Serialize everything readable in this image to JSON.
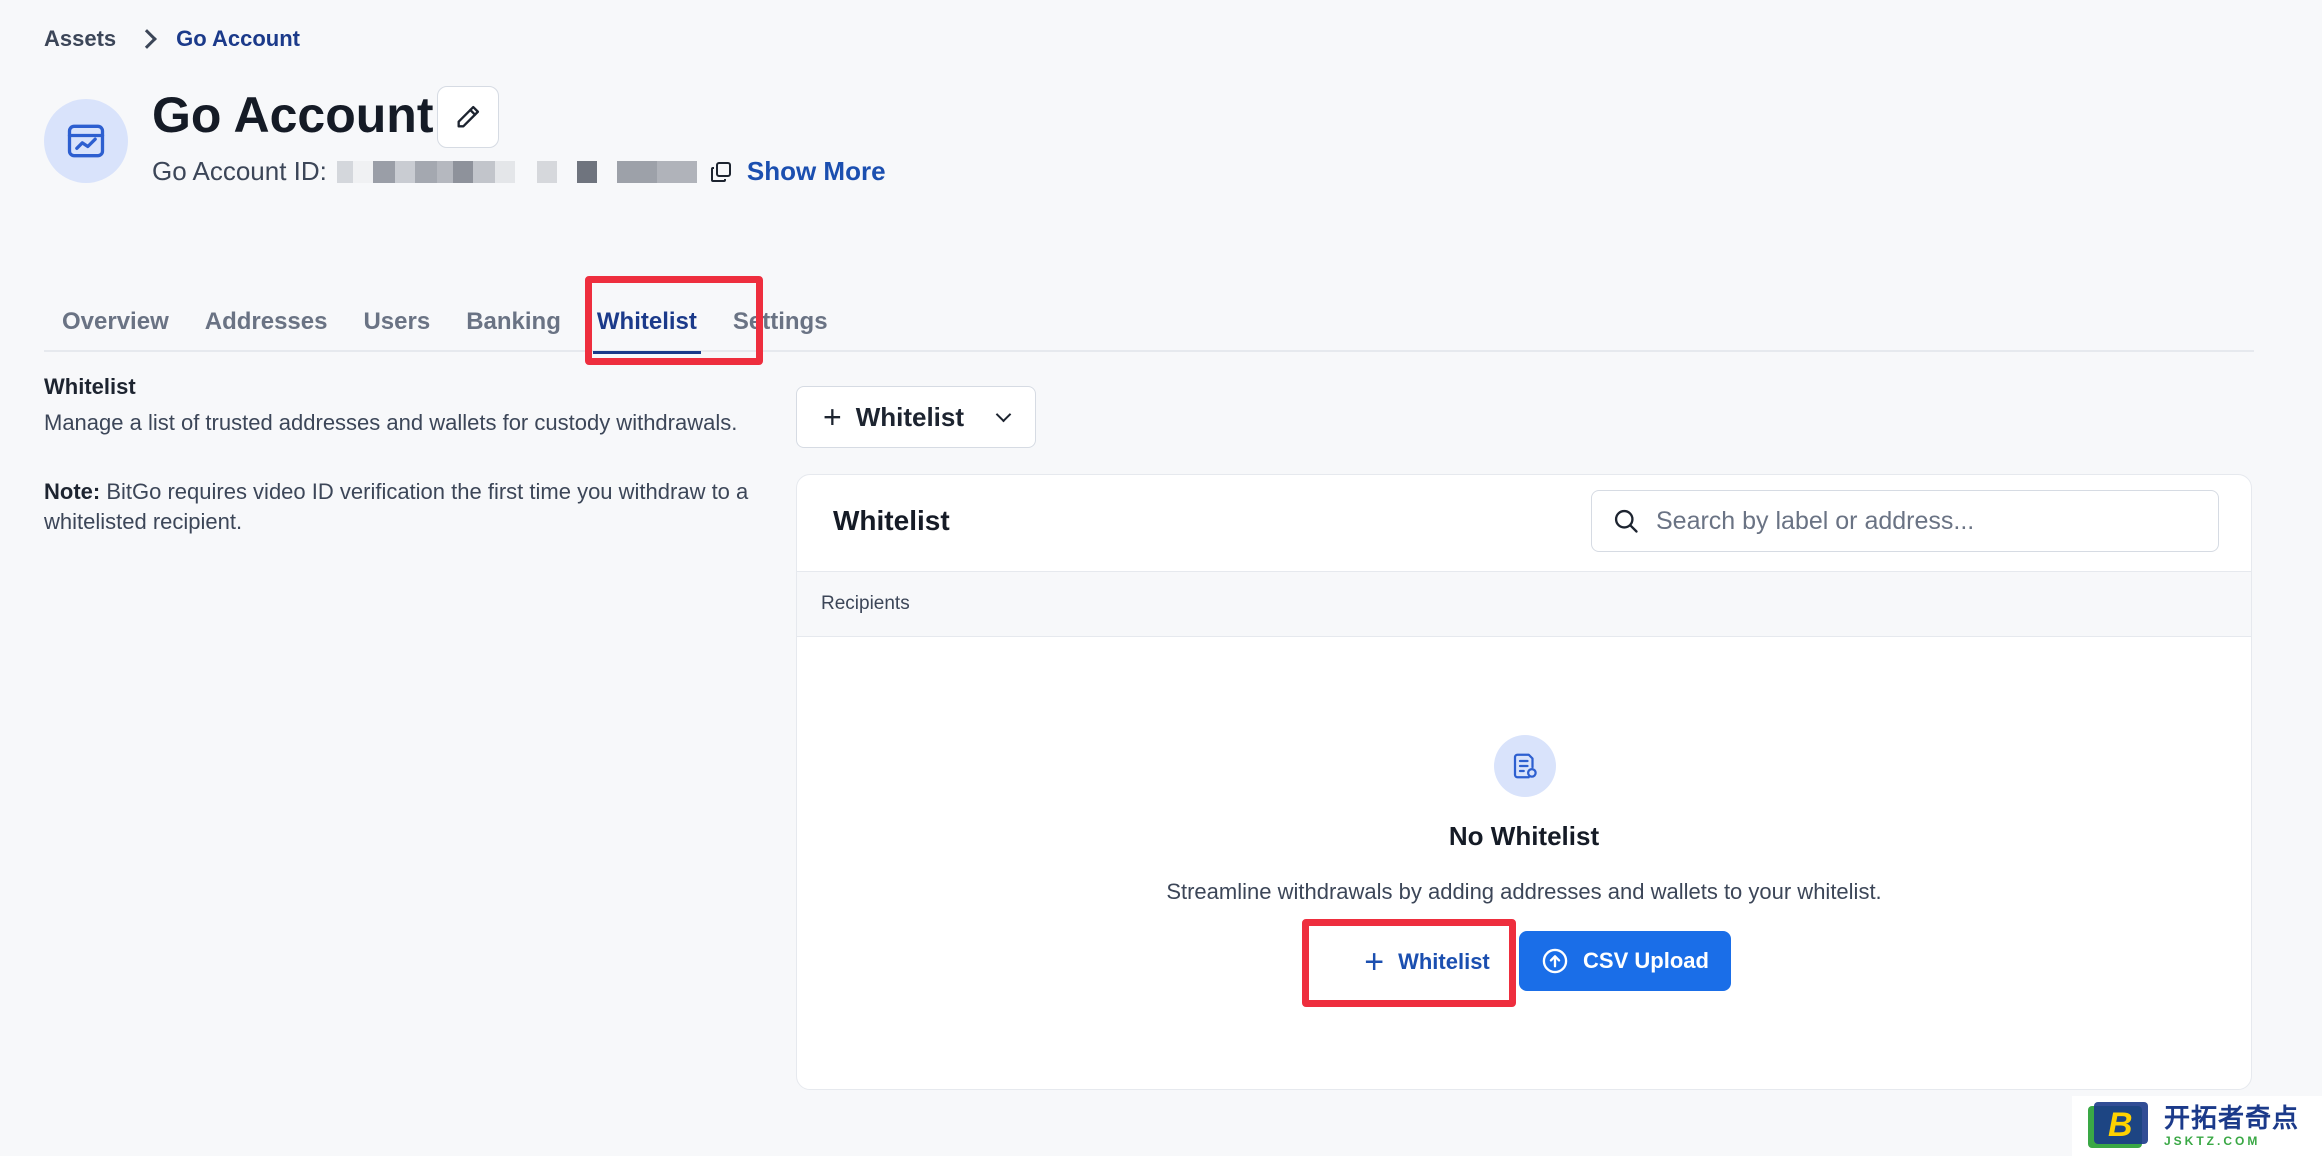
{
  "breadcrumb": {
    "root": "Assets",
    "current": "Go Account"
  },
  "header": {
    "title": "Go Account",
    "account_id_label": "Go Account ID:",
    "show_more": "Show More"
  },
  "tabs": [
    {
      "label": "Overview",
      "active": false
    },
    {
      "label": "Addresses",
      "active": false
    },
    {
      "label": "Users",
      "active": false
    },
    {
      "label": "Banking",
      "active": false
    },
    {
      "label": "Whitelist",
      "active": true
    },
    {
      "label": "Settings",
      "active": false
    }
  ],
  "description": {
    "title": "Whitelist",
    "text": "Manage a list of trusted addresses and wallets for custody withdrawals.",
    "note_label": "Note:",
    "note_text": " BitGo requires video ID verification the first time you withdraw to a whitelisted recipient."
  },
  "add_dropdown": {
    "label": "Whitelist"
  },
  "card": {
    "title": "Whitelist",
    "search_placeholder": "Search by label or address...",
    "column_header": "Recipients",
    "empty_title": "No Whitelist",
    "empty_text": "Streamline withdrawals by adding addresses and wallets to your whitelist.",
    "add_button": "Whitelist",
    "csv_button": "CSV Upload"
  },
  "watermark": {
    "text": "开拓者奇点",
    "url": "JSKTZ.COM"
  },
  "colors": {
    "accent": "#1b3a8a",
    "primary_button": "#1a6ee8",
    "highlight": "#ee2e3e"
  }
}
